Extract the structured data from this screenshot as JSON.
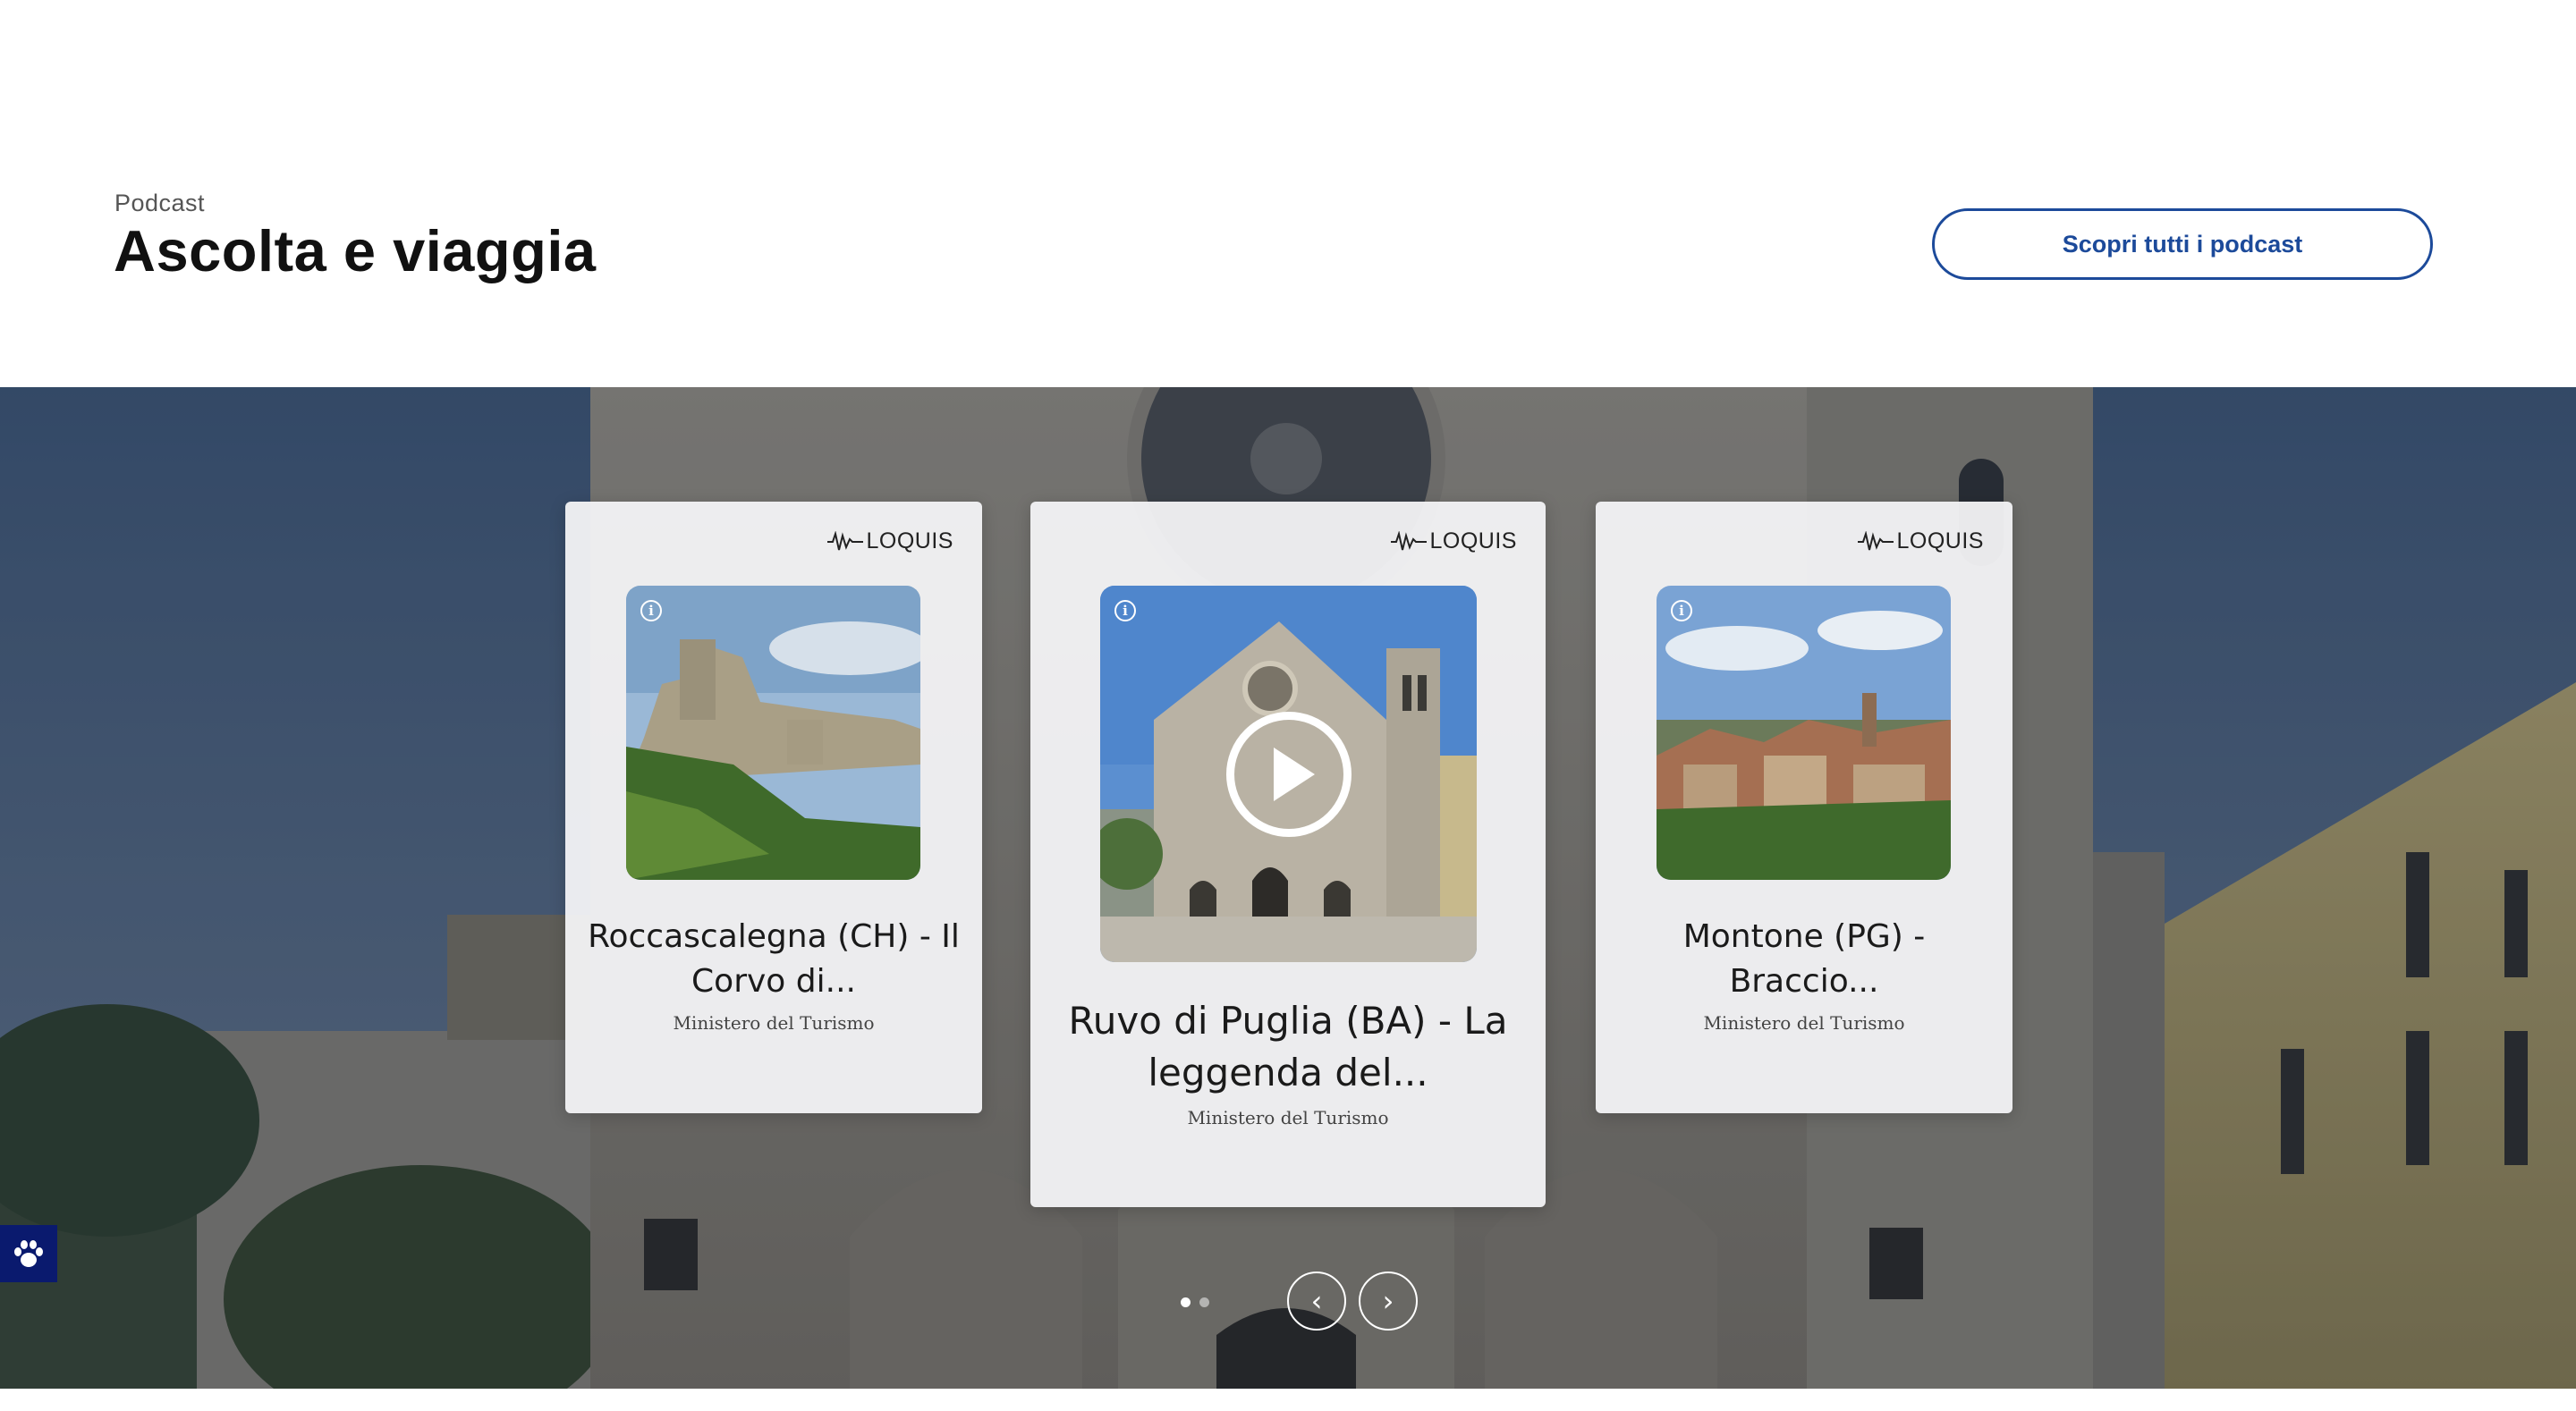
{
  "header": {
    "eyebrow": "Podcast",
    "title": "Ascolta e viaggia",
    "cta_label": "Scopri tutti i podcast"
  },
  "carousel": {
    "brand_label": "LOQUIS",
    "cards": [
      {
        "title": "Roccascalegna (CH) - Il Corvo di...",
        "subtitle": "Ministero del Turismo",
        "info_icon": "info-icon"
      },
      {
        "title": "Ruvo di Puglia (BA) - La leggenda del...",
        "subtitle": "Ministero del Turismo",
        "info_icon": "info-icon",
        "play_icon": "play-icon"
      },
      {
        "title": "Montone (PG) - Braccio...",
        "subtitle": "Ministero del Turismo",
        "info_icon": "info-icon"
      }
    ],
    "pagination": {
      "total": 2,
      "active": 1
    },
    "prev_icon": "chevron-left-icon",
    "next_icon": "chevron-right-icon"
  },
  "accessibility_icon": "paw-icon",
  "colors": {
    "accent": "#1c4a9a",
    "a11y_bg": "#0a1a6e"
  }
}
